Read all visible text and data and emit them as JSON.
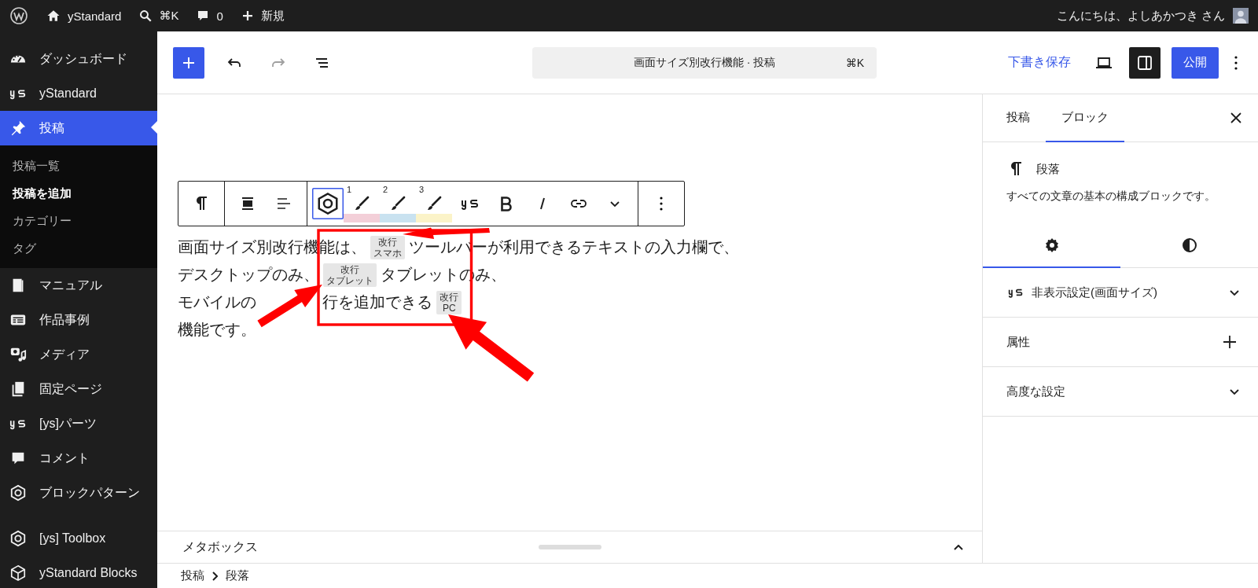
{
  "admin_bar": {
    "site": "yStandard",
    "search_shortcut": "⌘K",
    "comments": "0",
    "new": "新規",
    "greeting": "こんにちは、よしあかつき さん"
  },
  "admin_menu": [
    {
      "label": "ダッシュボード",
      "selected": false
    },
    {
      "label": "yStandard",
      "selected": false
    },
    {
      "label": "投稿",
      "selected": true,
      "children": [
        {
          "label": "投稿一覧",
          "selected": false
        },
        {
          "label": "投稿を追加",
          "selected": true
        },
        {
          "label": "カテゴリー",
          "selected": false
        },
        {
          "label": "タグ",
          "selected": false
        }
      ]
    },
    {
      "label": "マニュアル",
      "selected": false
    },
    {
      "label": "作品事例",
      "selected": false
    },
    {
      "label": "メディア",
      "selected": false
    },
    {
      "label": "固定ページ",
      "selected": false
    },
    {
      "label": "[ys]パーツ",
      "selected": false
    },
    {
      "label": "コメント",
      "selected": false
    },
    {
      "label": "ブロックパターン",
      "selected": false
    },
    {
      "label": "[ys] Toolbox",
      "selected": false
    },
    {
      "label": "yStandard Blocks",
      "selected": false
    }
  ],
  "header": {
    "redo_disabled": true,
    "command_title": "画面サイズ別改行機能 · 投稿",
    "command_shortcut": "⌘K",
    "save_draft": "下書き保存",
    "sidebar_toggle_on": true,
    "publish": "公開"
  },
  "block_toolbar": {
    "ys_tool_selected": true,
    "highlighters": [
      {
        "number": "1",
        "color": "#f3cfd8"
      },
      {
        "number": "2",
        "color": "#c9e2f0"
      },
      {
        "number": "3",
        "color": "#fbf3c8"
      }
    ]
  },
  "content": {
    "lines": [
      [
        {
          "kind": "text",
          "text": "画面サイズ別改行機能は、"
        },
        {
          "kind": "badge",
          "top": "改行",
          "bottom": "スマホ"
        },
        {
          "kind": "text",
          "text": "ツールバーが利用できるテキストの入力欄で、"
        }
      ],
      [
        {
          "kind": "text",
          "text": "デスクトップのみ、"
        },
        {
          "kind": "badge",
          "top": "改行",
          "bottom": "タブレット"
        },
        {
          "kind": "text",
          "text": "タブレットのみ、"
        }
      ],
      [
        {
          "kind": "text",
          "text": "モバイルの"
        },
        {
          "kind": "gap"
        },
        {
          "kind": "text",
          "text": "行を追加できる"
        },
        {
          "kind": "badge",
          "top": "改行",
          "bottom": "PC"
        }
      ],
      [
        {
          "kind": "text",
          "text": "機能です。"
        }
      ]
    ]
  },
  "metabox": {
    "label": "メタボックス",
    "expanded": false
  },
  "breadcrumb": [
    "投稿",
    "段落"
  ],
  "sidebar": {
    "tabs": [
      {
        "label": "投稿",
        "selected": false
      },
      {
        "label": "ブロック",
        "selected": true
      }
    ],
    "block_name": "段落",
    "block_description": "すべての文章の基本の構成ブロックです。",
    "icon_tabs": [
      {
        "selected": true
      },
      {
        "selected": false
      }
    ],
    "panels": [
      {
        "label": "非表示設定(画面サイズ)",
        "kind": "chevron",
        "ys": true
      },
      {
        "label": "属性",
        "kind": "plus",
        "ys": false
      },
      {
        "label": "高度な設定",
        "kind": "chevron",
        "ys": false
      }
    ]
  }
}
